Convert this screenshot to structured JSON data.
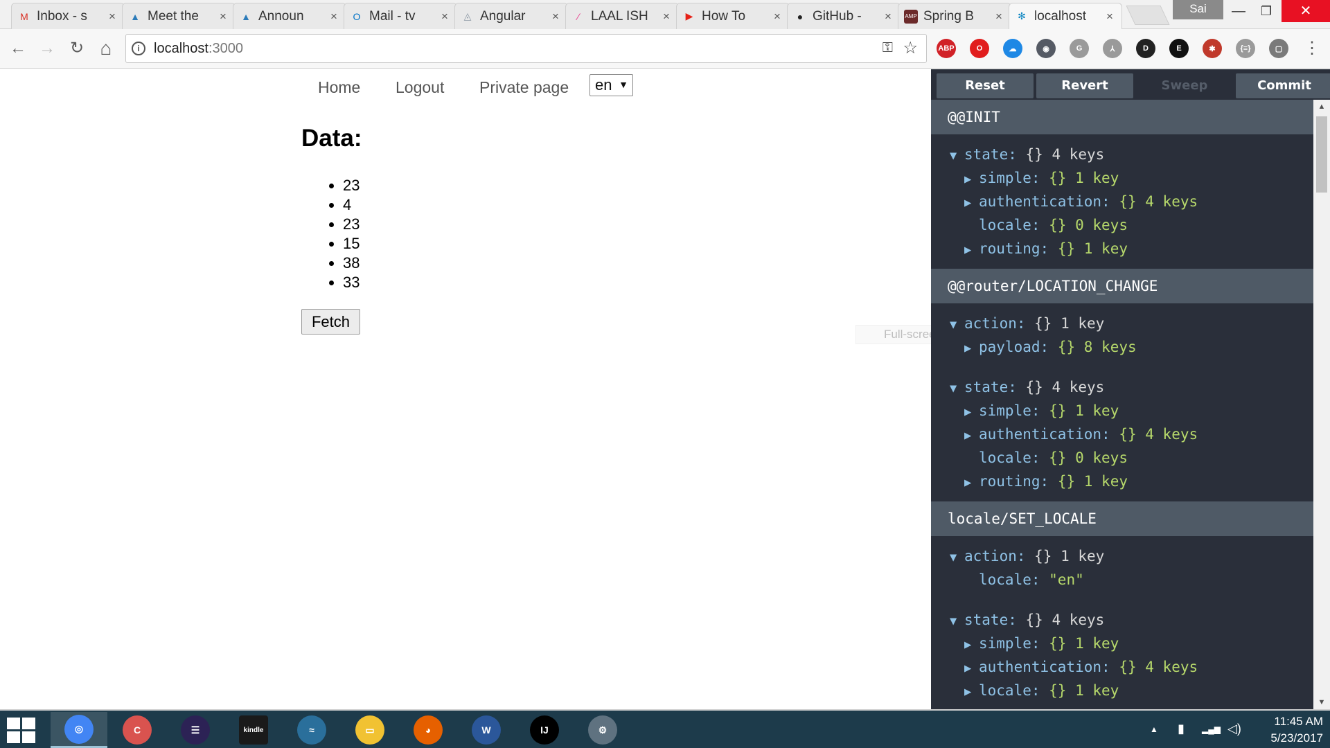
{
  "browser": {
    "tabs": [
      {
        "title": "Inbox - s",
        "icon": "gmail-icon",
        "color": "#d93025",
        "glyph": "M"
      },
      {
        "title": "Meet the",
        "icon": "bitbucket-tower-icon",
        "color": "#2b7bb9",
        "glyph": "▲"
      },
      {
        "title": "Announ",
        "icon": "bitbucket-tower-icon",
        "color": "#2b7bb9",
        "glyph": "▲"
      },
      {
        "title": "Mail - tv",
        "icon": "outlook-icon",
        "color": "#0072c6",
        "glyph": "O"
      },
      {
        "title": "Angular",
        "icon": "angular-icon",
        "color": "#8e9aa6",
        "glyph": "◬"
      },
      {
        "title": "LAAL ISH",
        "icon": "pink-app-icon",
        "color": "#e83e8c",
        "glyph": "∕"
      },
      {
        "title": "How To",
        "icon": "youtube-icon",
        "color": "#e62117",
        "glyph": "▶"
      },
      {
        "title": "GitHub -",
        "icon": "github-icon",
        "color": "#222222",
        "glyph": "●"
      },
      {
        "title": "Spring B",
        "icon": "amp-icon",
        "color": "#6b2a2a",
        "glyph": "AMP"
      },
      {
        "title": "localhost",
        "icon": "react-icon",
        "color": "#0a84c1",
        "glyph": "✻"
      }
    ],
    "close_glyph": "×",
    "user_label": "Sai",
    "window_controls": {
      "minimize": "—",
      "maximize": "❐",
      "close": "✕"
    },
    "nav": {
      "back": "←",
      "forward": "→",
      "reload": "↻",
      "home": "⌂"
    },
    "url_host": "localhost",
    "url_port": ":3000",
    "info_glyph": "i",
    "key_glyph": "⚿",
    "star_glyph": "☆",
    "extensions": [
      {
        "name": "adblock-plus-icon",
        "label": "ABP",
        "color": "#d12127"
      },
      {
        "name": "opera-vpn-icon",
        "label": "O",
        "color": "#e11d1d"
      },
      {
        "name": "onedrive-icon",
        "label": "☁",
        "color": "#1e88e5"
      },
      {
        "name": "eye-extension-icon",
        "label": "◉",
        "color": "#555a64"
      },
      {
        "name": "g-extension-icon",
        "label": "G",
        "color": "#9a9a9a"
      },
      {
        "name": "pdf-extension-icon",
        "label": "⅄",
        "color": "#9a9a9a"
      },
      {
        "name": "d-extension-icon",
        "label": "D",
        "color": "#222222"
      },
      {
        "name": "e-badge-extension-icon",
        "label": "E",
        "color": "#111111"
      },
      {
        "name": "redux-devtools-extension-icon",
        "label": "✱",
        "color": "#c0392b"
      },
      {
        "name": "json-extension-icon",
        "label": "{≡}",
        "color": "#9a9a9a"
      },
      {
        "name": "square-extension-icon",
        "label": "▢",
        "color": "#7a7a7a"
      }
    ],
    "menu_glyph": "⋮"
  },
  "page": {
    "nav_links": [
      "Home",
      "Logout",
      "Private page"
    ],
    "locale_value": "en",
    "locale_arrow": "▼",
    "data_title": "Data:",
    "data_values": [
      "23",
      "4",
      "23",
      "15",
      "38",
      "33"
    ],
    "fetch_label": "Fetch",
    "snip_ghost": "Full-screen Snip"
  },
  "devtools": {
    "buttons": [
      {
        "label": "Reset",
        "enabled": true
      },
      {
        "label": "Revert",
        "enabled": true
      },
      {
        "label": "Sweep",
        "enabled": false
      },
      {
        "label": "Commit",
        "enabled": true
      }
    ],
    "actions": [
      {
        "title": "@@INIT",
        "blocks": [
          {
            "root": "state",
            "count": "4 keys",
            "children": [
              {
                "key": "simple",
                "count": "1 key",
                "expandable": true
              },
              {
                "key": "authentication",
                "count": "4 keys",
                "expandable": true
              },
              {
                "key": "locale",
                "count": "0 keys",
                "expandable": false
              },
              {
                "key": "routing",
                "count": "1 key",
                "expandable": true
              }
            ]
          }
        ]
      },
      {
        "title": "@@router/LOCATION_CHANGE",
        "blocks": [
          {
            "root": "action",
            "count": "1 key",
            "children": [
              {
                "key": "payload",
                "count": "8 keys",
                "expandable": true
              }
            ]
          },
          {
            "root": "state",
            "count": "4 keys",
            "children": [
              {
                "key": "simple",
                "count": "1 key",
                "expandable": true
              },
              {
                "key": "authentication",
                "count": "4 keys",
                "expandable": true
              },
              {
                "key": "locale",
                "count": "0 keys",
                "expandable": false
              },
              {
                "key": "routing",
                "count": "1 key",
                "expandable": true
              }
            ]
          }
        ]
      },
      {
        "title": "locale/SET_LOCALE",
        "blocks": [
          {
            "root": "action",
            "count": "1 key",
            "children": [
              {
                "key": "locale",
                "value": "\"en\"",
                "expandable": false
              }
            ]
          },
          {
            "root": "state",
            "count": "4 keys",
            "children": [
              {
                "key": "simple",
                "count": "1 key",
                "expandable": true
              },
              {
                "key": "authentication",
                "count": "4 keys",
                "expandable": true
              },
              {
                "key": "locale",
                "count": "1 key",
                "expandable": true
              }
            ]
          }
        ]
      }
    ]
  },
  "taskbar": {
    "apps": [
      {
        "name": "chrome-taskbar-icon",
        "glyph": "◎",
        "color": "#4285f4"
      },
      {
        "name": "ccleaner-taskbar-icon",
        "glyph": "C",
        "color": "#d9534f"
      },
      {
        "name": "eclipse-taskbar-icon",
        "glyph": "☰",
        "color": "#2c2255"
      },
      {
        "name": "kindle-taskbar-icon",
        "glyph": "kindle",
        "color": "#1a1a1a"
      },
      {
        "name": "mysql-workbench-taskbar-icon",
        "glyph": "≈",
        "color": "#2a6f9b"
      },
      {
        "name": "file-explorer-taskbar-icon",
        "glyph": "▭",
        "color": "#f1c232"
      },
      {
        "name": "firefox-taskbar-icon",
        "glyph": "◕",
        "color": "#e66000"
      },
      {
        "name": "word-taskbar-icon",
        "glyph": "W",
        "color": "#2b579a"
      },
      {
        "name": "intellij-taskbar-icon",
        "glyph": "IJ",
        "color": "#000000"
      },
      {
        "name": "settings-taskbar-icon",
        "glyph": "⚙",
        "color": "#5f7280"
      }
    ],
    "tray_chevron": "▲",
    "tray_battery": "▮",
    "tray_network": "▂▄▆",
    "tray_volume": "◁)",
    "time": "11:45 AM",
    "date": "5/23/2017"
  }
}
